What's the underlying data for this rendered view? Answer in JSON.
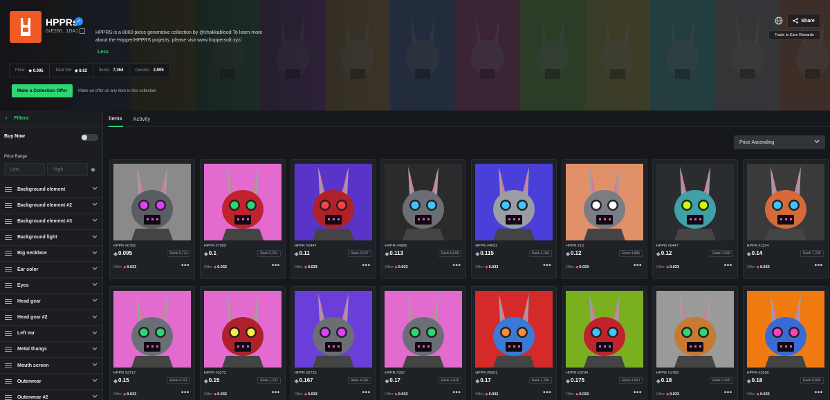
{
  "collection": {
    "name": "HPPRs",
    "contract": "0xE260...1DA1",
    "description": "HPPRS is a 8000 piece generative collection by @shakkablood To learn more about the Hopper/HPPRS projects, please visit www.hoppersnft.xyz/",
    "less_label": "Less"
  },
  "stats": {
    "floor_label": "Floor:",
    "floor_value": "0.095",
    "vol_label": "Total Vol:",
    "vol_value": "8.62",
    "items_label": "Items:",
    "items_value": "7,364",
    "owners_label": "Owners:",
    "owners_value": "2,905"
  },
  "actions": {
    "collection_offer": "Make a Collection Offer",
    "offer_hint": "Make an offer on any item in this collection",
    "share": "Share",
    "rewards": "Trade to Earn Rewards"
  },
  "sidebar": {
    "filters": "Filters",
    "buy_now": "Buy Now",
    "price_range": "Price Range",
    "low_placeholder": "Low",
    "high_placeholder": "High",
    "traits": [
      "Background element",
      "Background element #2",
      "Background element #3",
      "Background light",
      "Big necklace",
      "Ear color",
      "Eyes",
      "Head gear",
      "Head gear #2",
      "Left ear",
      "Metal thangs",
      "Mouth screen",
      "Outerwear",
      "Outerwear #2"
    ]
  },
  "tabs": {
    "items": "Items",
    "activity": "Activity"
  },
  "sort": {
    "selected": "Price Ascending"
  },
  "items": [
    {
      "name": "HPPR #6782",
      "price": "0.095",
      "rank": "Rank 5,724",
      "offer": "0.033",
      "bg": "#8a8a8a",
      "head": "#5a5d63",
      "eyes": "#e040fb"
    },
    {
      "name": "HPPR #7099",
      "price": "0.1",
      "rank": "Rank 5,251",
      "offer": "0.033",
      "bg": "#e36bd0",
      "head": "#c0232e",
      "eyes": "#2ed573"
    },
    {
      "name": "HPPR #2447",
      "price": "0.11",
      "rank": "Rank 5,537",
      "offer": "0.033",
      "bg": "#5a34c9",
      "head": "#b0202a",
      "eyes": "#ff4040"
    },
    {
      "name": "HPPR #4886",
      "price": "0.113",
      "rank": "Rank 6,695",
      "offer": "0.033",
      "bg": "#2b2b2b",
      "head": "#6b6e74",
      "eyes": "#40c4ff"
    },
    {
      "name": "HPPR #4691",
      "price": "0.115",
      "rank": "Rank 4,046",
      "offer": "0.033",
      "bg": "#4a3fd9",
      "head": "#9a9da3",
      "eyes": "#40c4ff"
    },
    {
      "name": "HPPR #13",
      "price": "0.12",
      "rank": "Rank 4,986",
      "offer": "0.033",
      "bg": "#e0916a",
      "head": "#7a7d83",
      "eyes": "#ffffff"
    },
    {
      "name": "HPPR #6447",
      "price": "0.12",
      "rank": "Rank 2,068",
      "offer": "0.033",
      "bg": "#2a2c30",
      "head": "#3fa0a8",
      "eyes": "#c6ff00"
    },
    {
      "name": "HPPR #1154",
      "price": "0.14",
      "rank": "Rank 7,235",
      "offer": "0.033",
      "bg": "#3a3a3a",
      "head": "#d46a3a",
      "eyes": "#40c4ff"
    },
    {
      "name": "HPPR #2717",
      "price": "0.15",
      "rank": "Rank 4,761",
      "offer": "0.033",
      "bg": "#e36bd0",
      "head": "#6b6e74",
      "eyes": "#2ed573"
    },
    {
      "name": "HPPR #3272",
      "price": "0.15",
      "rank": "Rank 1,232",
      "offer": "0.033",
      "bg": "#e36bd0",
      "head": "#b0202a",
      "eyes": "#ffeb3b"
    },
    {
      "name": "HPPR #2725",
      "price": "0.167",
      "rank": "Rank 4,096",
      "offer": "0.033",
      "bg": "#6a3fd9",
      "head": "#6b6e74",
      "eyes": "#e040fb"
    },
    {
      "name": "HPPR #367",
      "price": "0.17",
      "rank": "Rank 2,636",
      "offer": "0.033",
      "bg": "#e36bd0",
      "head": "#6b6e74",
      "eyes": "#2ed573"
    },
    {
      "name": "HPPR #6091",
      "price": "0.17",
      "rank": "Rank 1,396",
      "offer": "0.033",
      "bg": "#d42a2a",
      "head": "#3a7ad4",
      "eyes": "#ff8a3d"
    },
    {
      "name": "HPPR #3704",
      "price": "0.175",
      "rank": "Rank 4,550",
      "offer": "0.033",
      "bg": "#7ab020",
      "head": "#c0232e",
      "eyes": "#40c4ff"
    },
    {
      "name": "HPPR #1768",
      "price": "0.18",
      "rank": "Rank 3,665",
      "offer": "0.033",
      "bg": "#9a9a9a",
      "head": "#c77a30",
      "eyes": "#2ed573"
    },
    {
      "name": "HPPR #3500",
      "price": "0.18",
      "rank": "Rank 6,805",
      "offer": "0.033",
      "bg": "#f07a10",
      "head": "#3a6ad4",
      "eyes": "#ff40c0"
    }
  ],
  "offer_label": "Offer",
  "colors": {
    "accent": "#2ed573",
    "brand": "#f05a24",
    "offer_eth": "#ff5a5f"
  }
}
